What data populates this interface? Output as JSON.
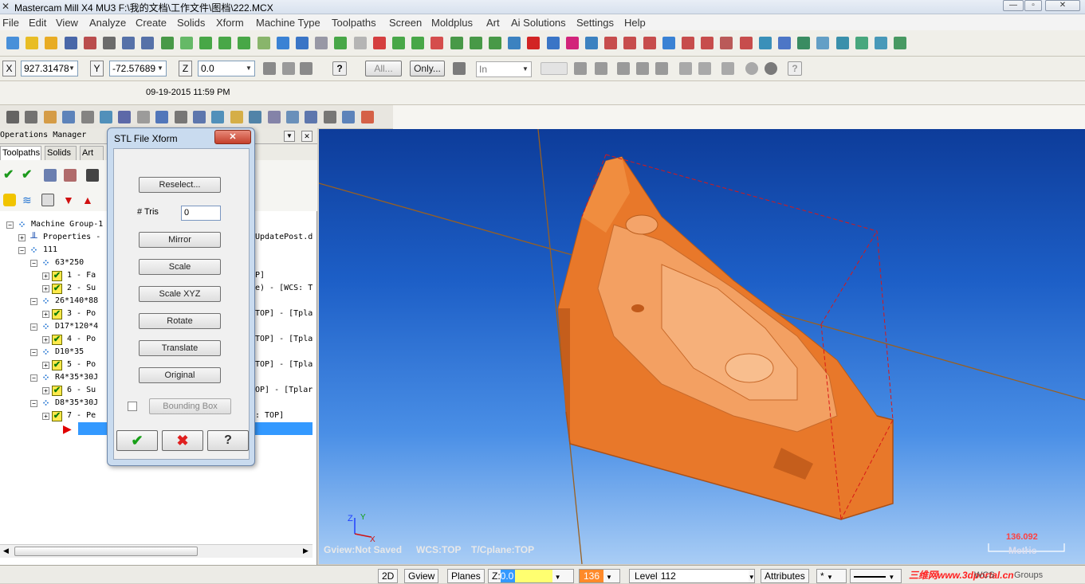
{
  "window": {
    "title": "Mastercam Mill X4 MU3  F:\\我的文档\\工作文件\\图档\\222.MCX"
  },
  "menu": [
    "File",
    "Edit",
    "View",
    "Analyze",
    "Create",
    "Solids",
    "Xform",
    "Machine Type",
    "Toolpaths",
    "Screen",
    "Moldplus",
    "Art",
    "Ai Solutions",
    "Settings",
    "Help"
  ],
  "coords": {
    "x_label": "X",
    "x_value": "927.31478",
    "y_label": "Y",
    "y_value": "-72.57689",
    "z_label": "Z",
    "z_value": "0.0"
  },
  "selection": {
    "all_label": "All...",
    "only_label": "Only...",
    "mode_value": "In"
  },
  "date_stamp": "09-19-2015 11:59 PM",
  "ops": {
    "title": "Operations Manager",
    "tabs": [
      "Toolpaths",
      "Solids",
      "Art"
    ],
    "tree": [
      {
        "text": "Machine Group-1",
        "ind": 0,
        "kind": "machine"
      },
      {
        "text": "Properties -",
        "ind": 1,
        "kind": "props"
      },
      {
        "text": "111",
        "ind": 1,
        "kind": "group"
      },
      {
        "text": "63*250",
        "ind": 2,
        "kind": "group"
      },
      {
        "text": "1 - Fa",
        "ind": 3,
        "kind": "op"
      },
      {
        "text": "2 - Su",
        "ind": 3,
        "kind": "op"
      },
      {
        "text": "26*140*88",
        "ind": 2,
        "kind": "group"
      },
      {
        "text": "3 - Po",
        "ind": 3,
        "kind": "op"
      },
      {
        "text": "D17*120*4",
        "ind": 2,
        "kind": "group"
      },
      {
        "text": "4 - Po",
        "ind": 3,
        "kind": "op"
      },
      {
        "text": "D10*35",
        "ind": 2,
        "kind": "group"
      },
      {
        "text": "5 - Po",
        "ind": 3,
        "kind": "op"
      },
      {
        "text": "R4*35*30J",
        "ind": 2,
        "kind": "group"
      },
      {
        "text": "6 - Su",
        "ind": 3,
        "kind": "op"
      },
      {
        "text": "D8*35*30J",
        "ind": 2,
        "kind": "group"
      },
      {
        "text": "7 - Pe",
        "ind": 3,
        "kind": "op"
      }
    ],
    "right_frags": [
      {
        "text": "UpdatePost.d",
        "row": 1
      },
      {
        "text": "P]",
        "row": 4
      },
      {
        "text": "e) - [WCS: T",
        "row": 5
      },
      {
        "text": "TOP] - [Tpla",
        "row": 7
      },
      {
        "text": "TOP] - [Tpla",
        "row": 9
      },
      {
        "text": "TOP] - [Tpla",
        "row": 11
      },
      {
        "text": "OP] - [Tplar",
        "row": 13
      },
      {
        "text": ": TOP]",
        "row": 15
      }
    ]
  },
  "dialog": {
    "title": "STL File Xform",
    "buttons": [
      "Reselect...",
      "Mirror",
      "Scale",
      "Scale XYZ",
      "Rotate",
      "Translate",
      "Original"
    ],
    "tris_label": "# Tris",
    "tris_value": "0",
    "bbox_label": "Bounding Box"
  },
  "viewport": {
    "gview": "Gview:Not Saved",
    "wcs": "WCS:TOP",
    "tcplane": "T/Cplane:TOP",
    "scale_value": "136.092",
    "scale_unit": "Metric"
  },
  "status": {
    "mode": "2D",
    "gview": "Gview",
    "planes": "Planes",
    "z_label": "Z:",
    "z_value": "0.0",
    "color_value": "136",
    "level_label": "Level",
    "level_value": "112",
    "attributes": "Attributes",
    "watermark": "三维网www.3dportal.cn",
    "wcs": "WCS",
    "groups": "Groups"
  },
  "colors": {
    "part": "#e8782a",
    "viewport_top": "#0d3c9a",
    "viewport_bottom": "#a9cdf5",
    "highlight": "#3399ff"
  }
}
